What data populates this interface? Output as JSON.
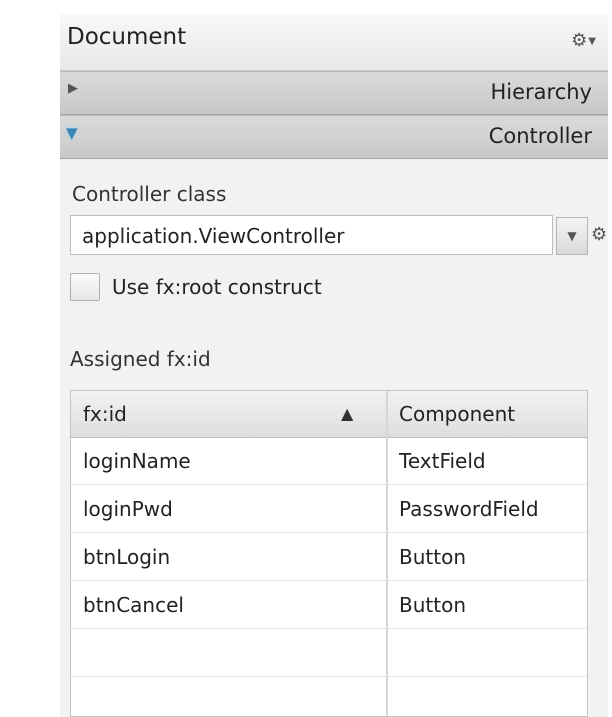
{
  "document_header": {
    "title": "Document",
    "gear_icon": "gear-icon"
  },
  "sections": {
    "hierarchy": {
      "label": "Hierarchy",
      "expanded": false
    },
    "controller": {
      "label": "Controller",
      "expanded": true
    }
  },
  "controller": {
    "class_label": "Controller class",
    "class_value": "application.ViewController",
    "use_root_label": "Use fx:root construct",
    "use_root_checked": false
  },
  "assigned": {
    "label": "Assigned fx:id",
    "columns": [
      "fx:id",
      "Component"
    ],
    "sort": "ascending",
    "rows": [
      {
        "fxid": "loginName",
        "component": "TextField"
      },
      {
        "fxid": "loginPwd",
        "component": "PasswordField"
      },
      {
        "fxid": "btnLogin",
        "component": "Button"
      },
      {
        "fxid": "btnCancel",
        "component": "Button"
      },
      {
        "fxid": "",
        "component": ""
      },
      {
        "fxid": "",
        "component": ""
      }
    ]
  },
  "colors": {
    "panel_bg": "#f2f2f2",
    "expand_accent": "#3a86b6"
  }
}
